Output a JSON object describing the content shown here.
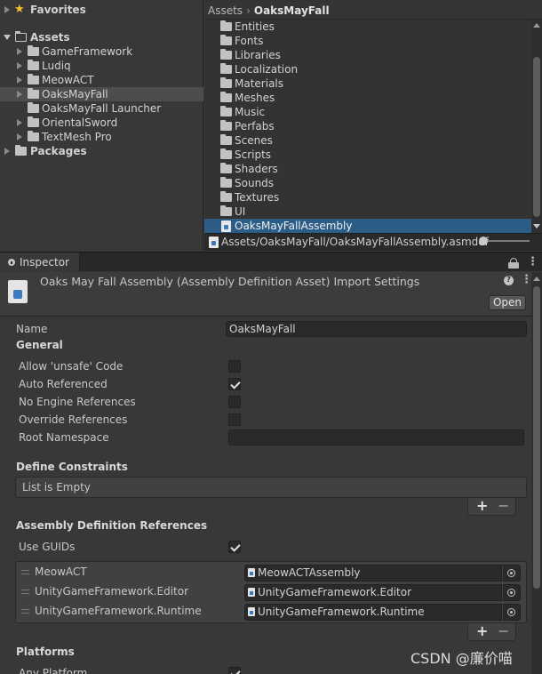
{
  "project_tree": {
    "favorites_label": "Favorites",
    "assets_label": "Assets",
    "packages_label": "Packages",
    "asset_children": [
      {
        "label": "GameFramework",
        "has_children": true,
        "selected": false
      },
      {
        "label": "Ludiq",
        "has_children": true,
        "selected": false
      },
      {
        "label": "MeowACT",
        "has_children": true,
        "selected": false
      },
      {
        "label": "OaksMayFall",
        "has_children": true,
        "selected": true
      },
      {
        "label": "OaksMayFall Launcher",
        "has_children": false,
        "selected": false
      },
      {
        "label": "OrientalSword",
        "has_children": true,
        "selected": false
      },
      {
        "label": "TextMesh Pro",
        "has_children": true,
        "selected": false
      }
    ]
  },
  "asset_list": {
    "breadcrumb": {
      "root": "Assets",
      "current": "OaksMayFall",
      "separator": "›"
    },
    "folders": [
      "Entities",
      "Fonts",
      "Libraries",
      "Localization",
      "Materials",
      "Meshes",
      "Music",
      "Perfabs",
      "Scenes",
      "Scripts",
      "Shaders",
      "Sounds",
      "Textures",
      "UI"
    ],
    "selected_item": "OaksMayFallAssembly",
    "path": "Assets/OaksMayFall/OaksMayFallAssembly.asmdef"
  },
  "inspector": {
    "tab_label": "Inspector",
    "title": "Oaks May Fall Assembly (Assembly Definition Asset) Import Settings",
    "help_glyph": "?",
    "menu_glyph": "⋮",
    "open_label": "Open",
    "name_label": "Name",
    "name_value": "OaksMayFall",
    "general_label": "General",
    "general_fields": [
      {
        "label": "Allow 'unsafe' Code",
        "checked": false
      },
      {
        "label": "Auto Referenced",
        "checked": true
      },
      {
        "label": "No Engine References",
        "checked": false
      },
      {
        "label": "Override References",
        "checked": false
      }
    ],
    "root_namespace_label": "Root Namespace",
    "root_namespace_value": "",
    "define_constraints_label": "Define Constraints",
    "define_constraints_empty": "List is Empty",
    "plus_glyph": "+",
    "minus_glyph": "−",
    "assembly_refs_label": "Assembly Definition References",
    "use_guids_label": "Use GUIDs",
    "use_guids_checked": true,
    "references": [
      {
        "label": "MeowACT",
        "value": "MeowACTAssembly"
      },
      {
        "label": "UnityGameFramework.Editor",
        "value": "UnityGameFramework.Editor"
      },
      {
        "label": "UnityGameFramework.Runtime",
        "value": "UnityGameFramework.Runtime"
      }
    ],
    "platforms_label": "Platforms",
    "any_platform_label": "Any Platform",
    "any_platform_checked": true
  },
  "watermark": "CSDN @廉价喵"
}
